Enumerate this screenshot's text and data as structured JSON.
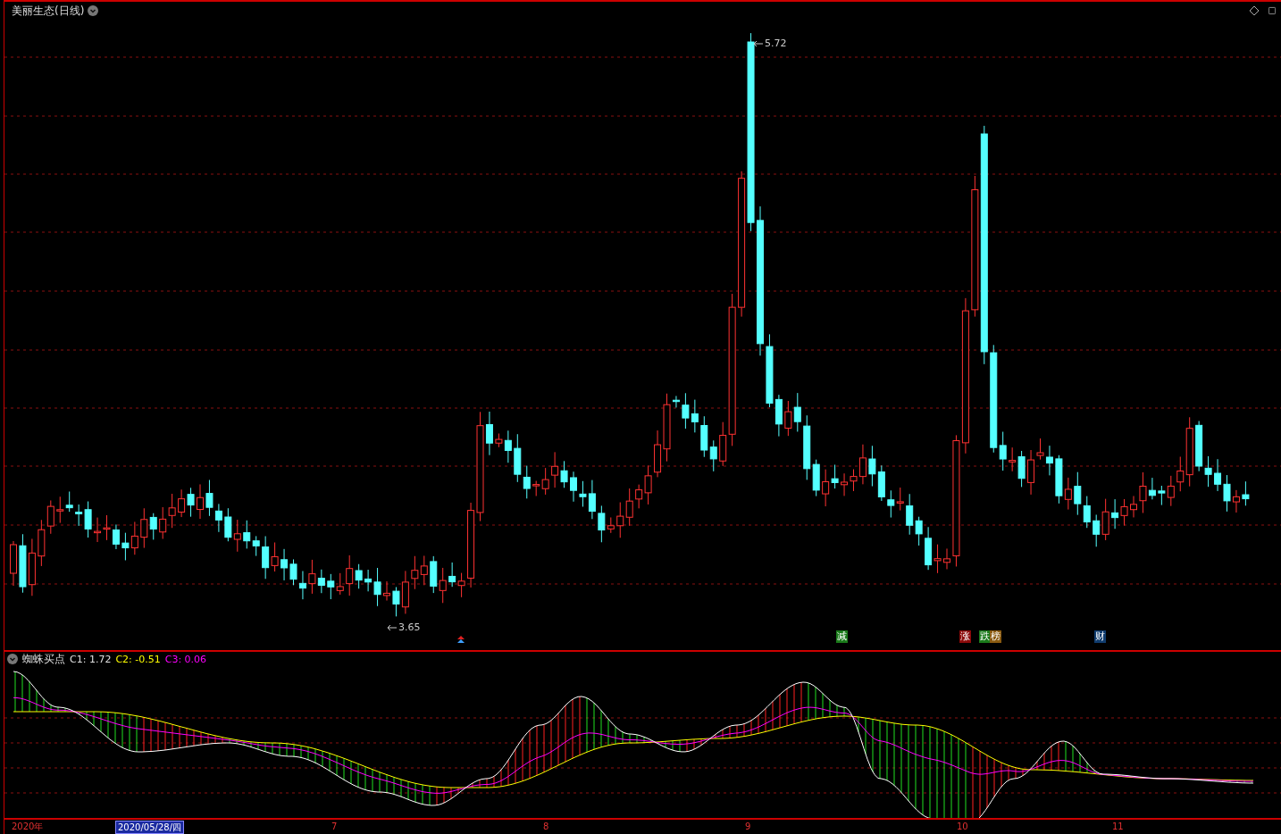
{
  "chart": {
    "title": "美丽生态(日线)",
    "price_markers": [
      {
        "label": "5.72"
      },
      {
        "label": "3.65"
      }
    ],
    "event_tags": [
      {
        "label": "减",
        "color": "#1a7a1a"
      },
      {
        "label": "涨",
        "color": "#8b0a0a"
      },
      {
        "label": "跌",
        "color": "#1a7a1a"
      },
      {
        "label": "榜",
        "color": "#8a5a10"
      },
      {
        "label": "财",
        "color": "#103c6e"
      }
    ]
  },
  "indicator": {
    "name": "蜘蛛买点",
    "readings": [
      {
        "label": "C1: 1.72",
        "color": "#e0e0e0"
      },
      {
        "label": "C2: -0.51",
        "color": "#ffff00"
      },
      {
        "label": "C3: 0.06",
        "color": "#ff00ff"
      }
    ]
  },
  "time_axis": [
    {
      "label": "2020年",
      "selected": false
    },
    {
      "label": "2020/05/28/四",
      "selected": true
    },
    {
      "label": "7",
      "selected": false
    },
    {
      "label": "8",
      "selected": false
    },
    {
      "label": "9",
      "selected": false
    },
    {
      "label": "10",
      "selected": false
    },
    {
      "label": "11",
      "selected": false
    }
  ]
}
